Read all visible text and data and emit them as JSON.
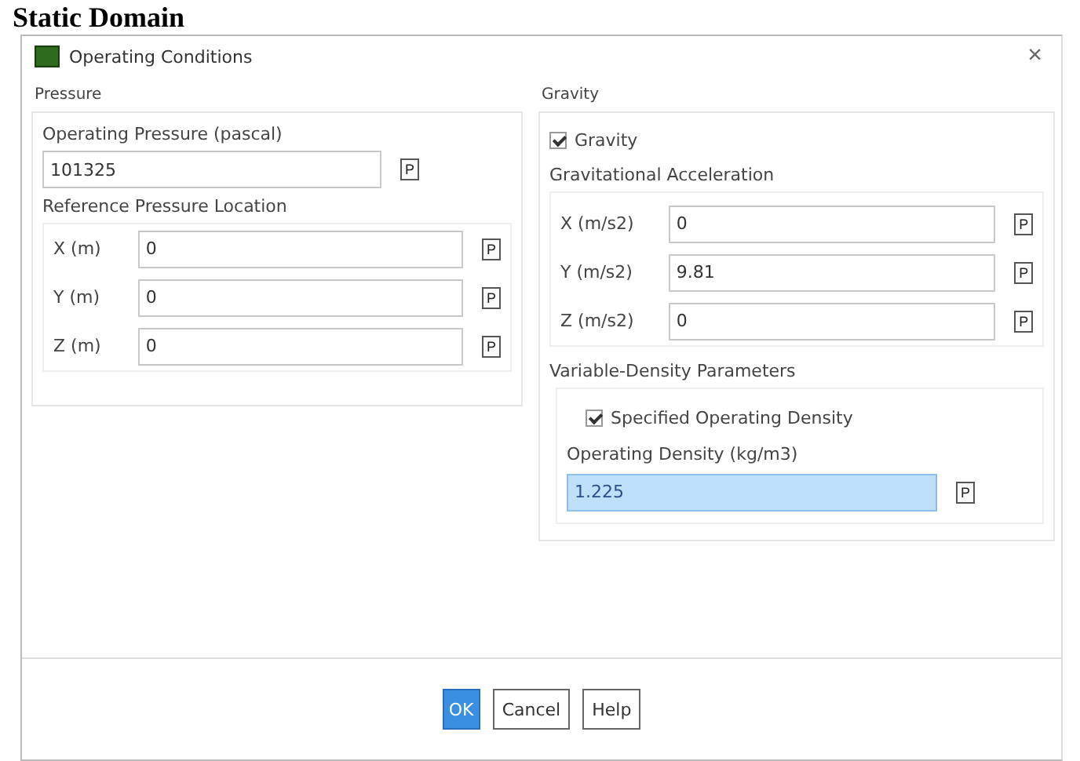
{
  "heading": "Static Domain",
  "window": {
    "title": "Operating Conditions",
    "close": "×"
  },
  "pressure": {
    "title": "Pressure",
    "operating_label": "Operating Pressure (pascal)",
    "operating": {
      "value": "101325",
      "param": "P"
    },
    "reference": {
      "title": "Reference Pressure Location",
      "fields": [
        {
          "label": "X (m)",
          "value": "0",
          "param": "P"
        },
        {
          "label": "Y (m)",
          "value": "0",
          "param": "P"
        },
        {
          "label": "Z (m)",
          "value": "0",
          "param": "P"
        }
      ]
    }
  },
  "gravity": {
    "title": "Gravity",
    "checkbox": {
      "label": "Gravity",
      "checked": true
    },
    "acceleration": {
      "title": "Gravitational Acceleration",
      "fields": [
        {
          "label": "X (m/s2)",
          "value": "0",
          "param": "P"
        },
        {
          "label": "Y (m/s2)",
          "value": "9.81",
          "param": "P"
        },
        {
          "label": "Z (m/s2)",
          "value": "0",
          "param": "P"
        }
      ]
    },
    "variable_density": {
      "title": "Variable-Density Parameters",
      "checkbox": {
        "label": "Specified Operating Density",
        "checked": true
      },
      "density_label": "Operating Density (kg/m3)",
      "density": {
        "value": "1.225",
        "param": "P",
        "highlighted": true
      }
    }
  },
  "buttons": [
    {
      "label": "OK",
      "default": true
    },
    {
      "label": "Cancel",
      "default": false
    },
    {
      "label": "Help",
      "default": false
    }
  ]
}
